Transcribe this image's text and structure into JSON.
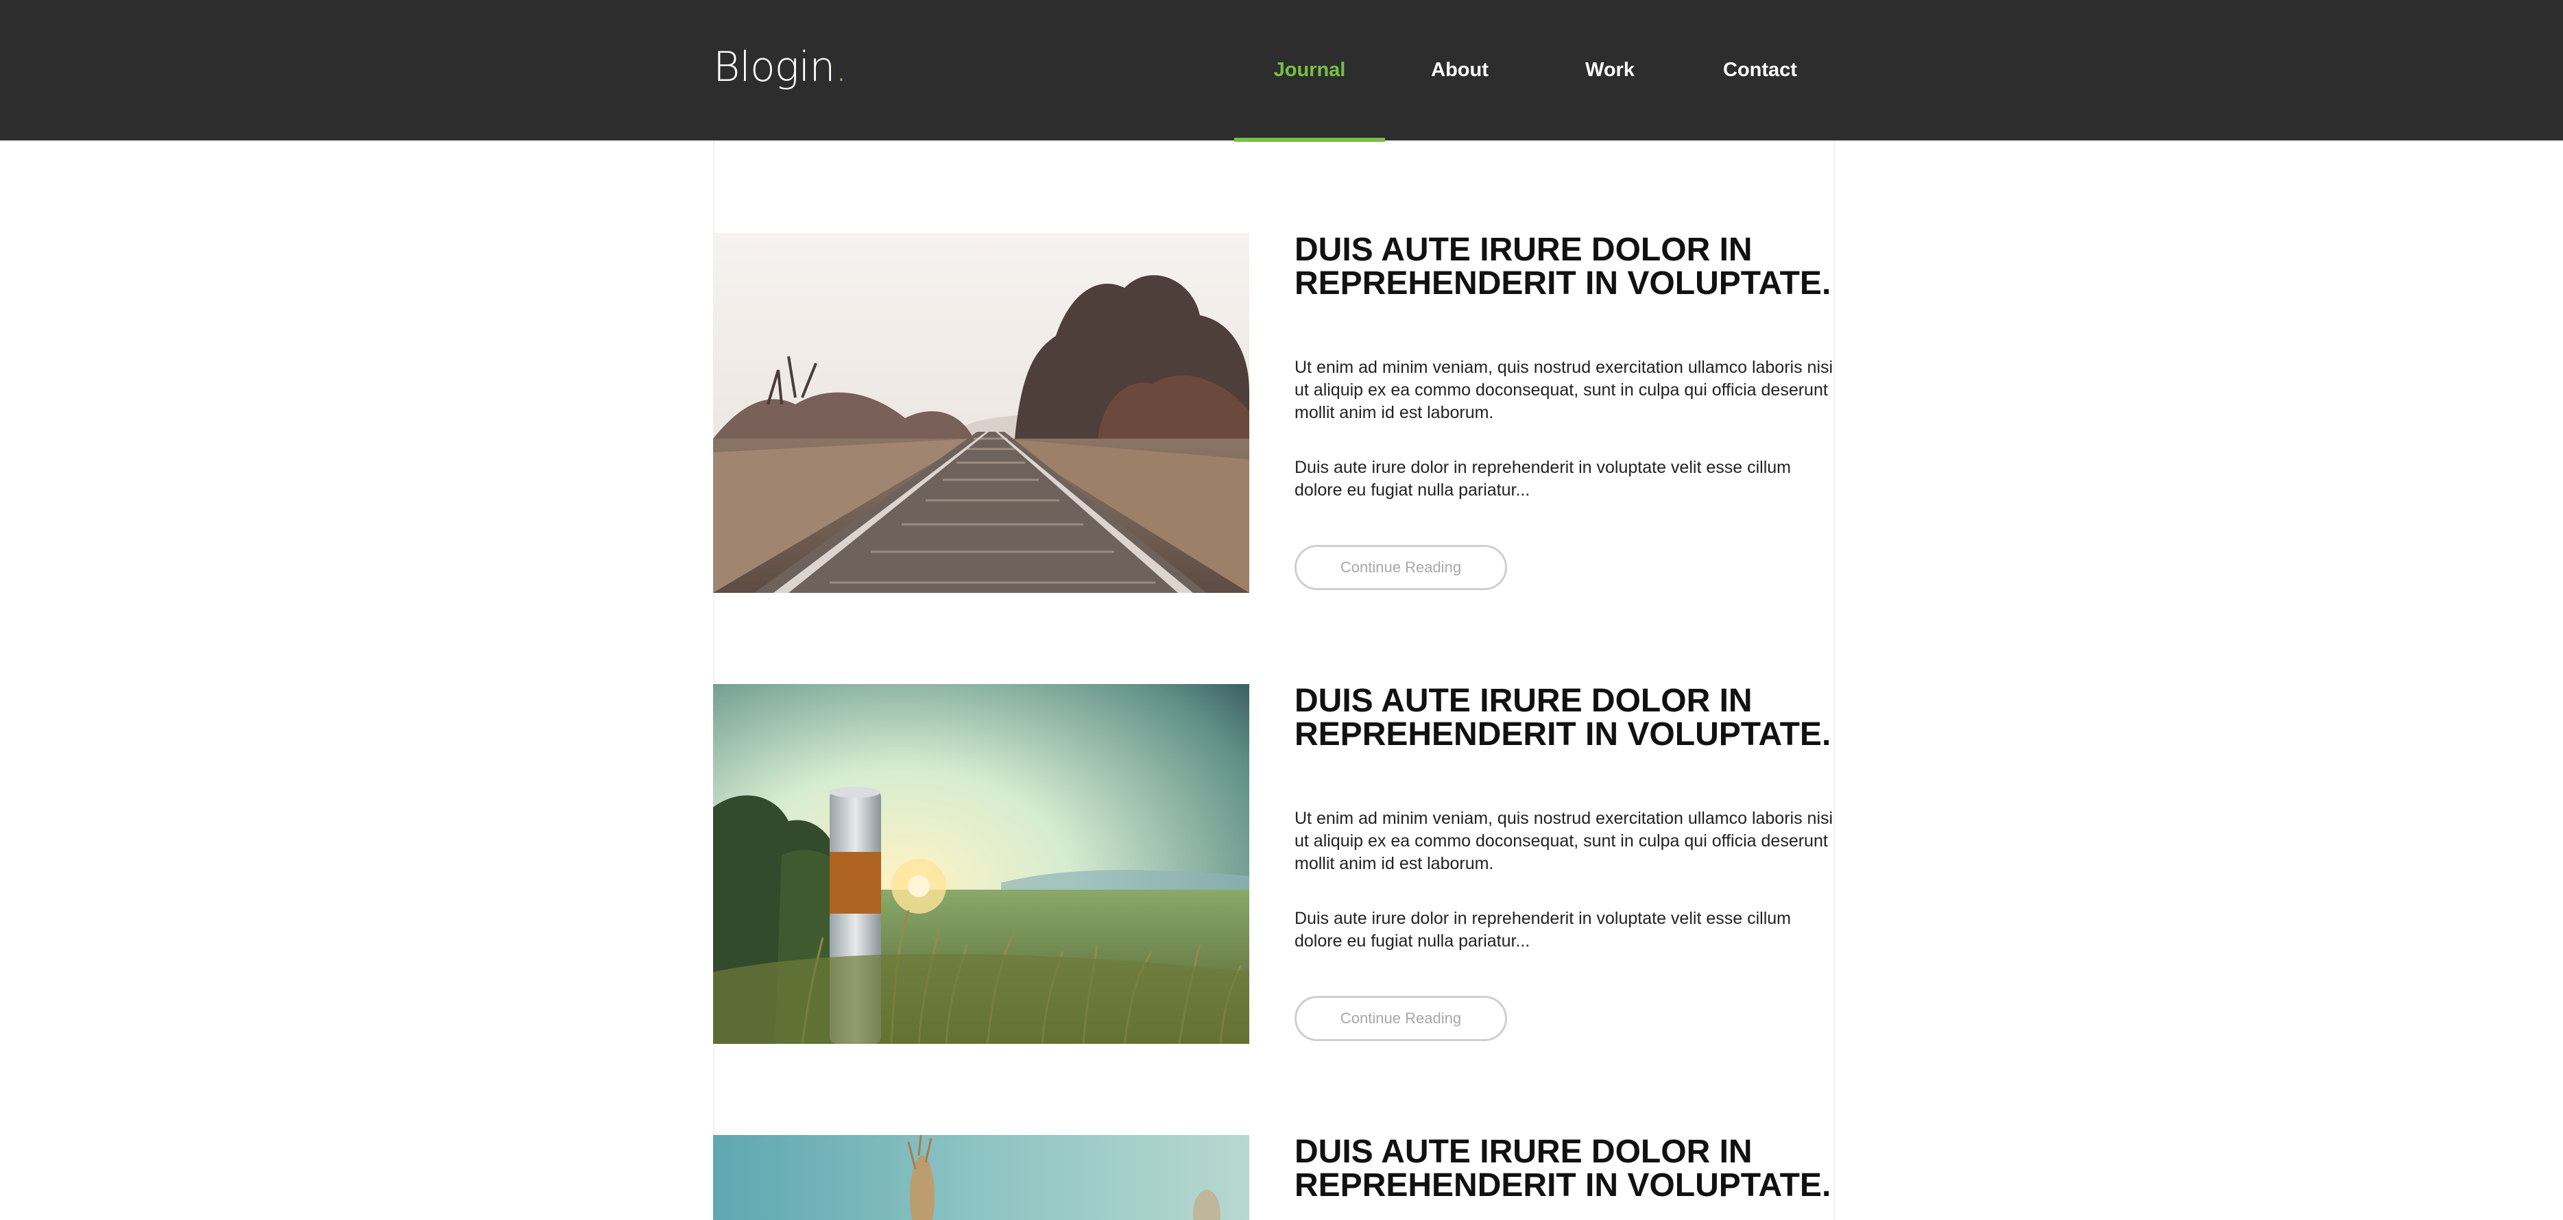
{
  "brand": {
    "name": "Blogin",
    "dot": ".",
    "accent": "#77c043"
  },
  "nav": {
    "items": [
      {
        "label": "Journal",
        "active": true
      },
      {
        "label": "About",
        "active": false
      },
      {
        "label": "Work",
        "active": false
      },
      {
        "label": "Contact",
        "active": false
      }
    ]
  },
  "posts": [
    {
      "image": "railway-tracks-photo",
      "title": "DUIS AUTE IRURE DOLOR IN REPREHENDERIT IN VOLUPTATE.",
      "paragraph1": "Ut enim ad minim veniam, quis nostrud exercitation ullamco laboris nisi ut aliquip ex ea commo doconsequat, sunt in culpa qui officia deserunt mollit anim id est laborum.",
      "paragraph2": "Duis aute irure dolor in reprehenderit in voluptate velit esse cillum dolore eu fugiat nulla pariatur...",
      "button_label": "Continue Reading"
    },
    {
      "image": "sunset-field-post-photo",
      "title": "DUIS AUTE IRURE DOLOR IN REPREHENDERIT IN VOLUPTATE.",
      "paragraph1": "Ut enim ad minim veniam, quis nostrud exercitation ullamco laboris nisi ut aliquip ex ea commo doconsequat, sunt in culpa qui officia deserunt mollit anim id est laborum.",
      "paragraph2": "Duis aute irure dolor in reprehenderit in voluptate velit esse cillum dolore eu fugiat nulla pariatur...",
      "button_label": "Continue Reading"
    },
    {
      "image": "wheat-sky-photo",
      "title": "DUIS AUTE IRURE DOLOR IN REPREHENDERIT IN VOLUPTATE."
    }
  ]
}
